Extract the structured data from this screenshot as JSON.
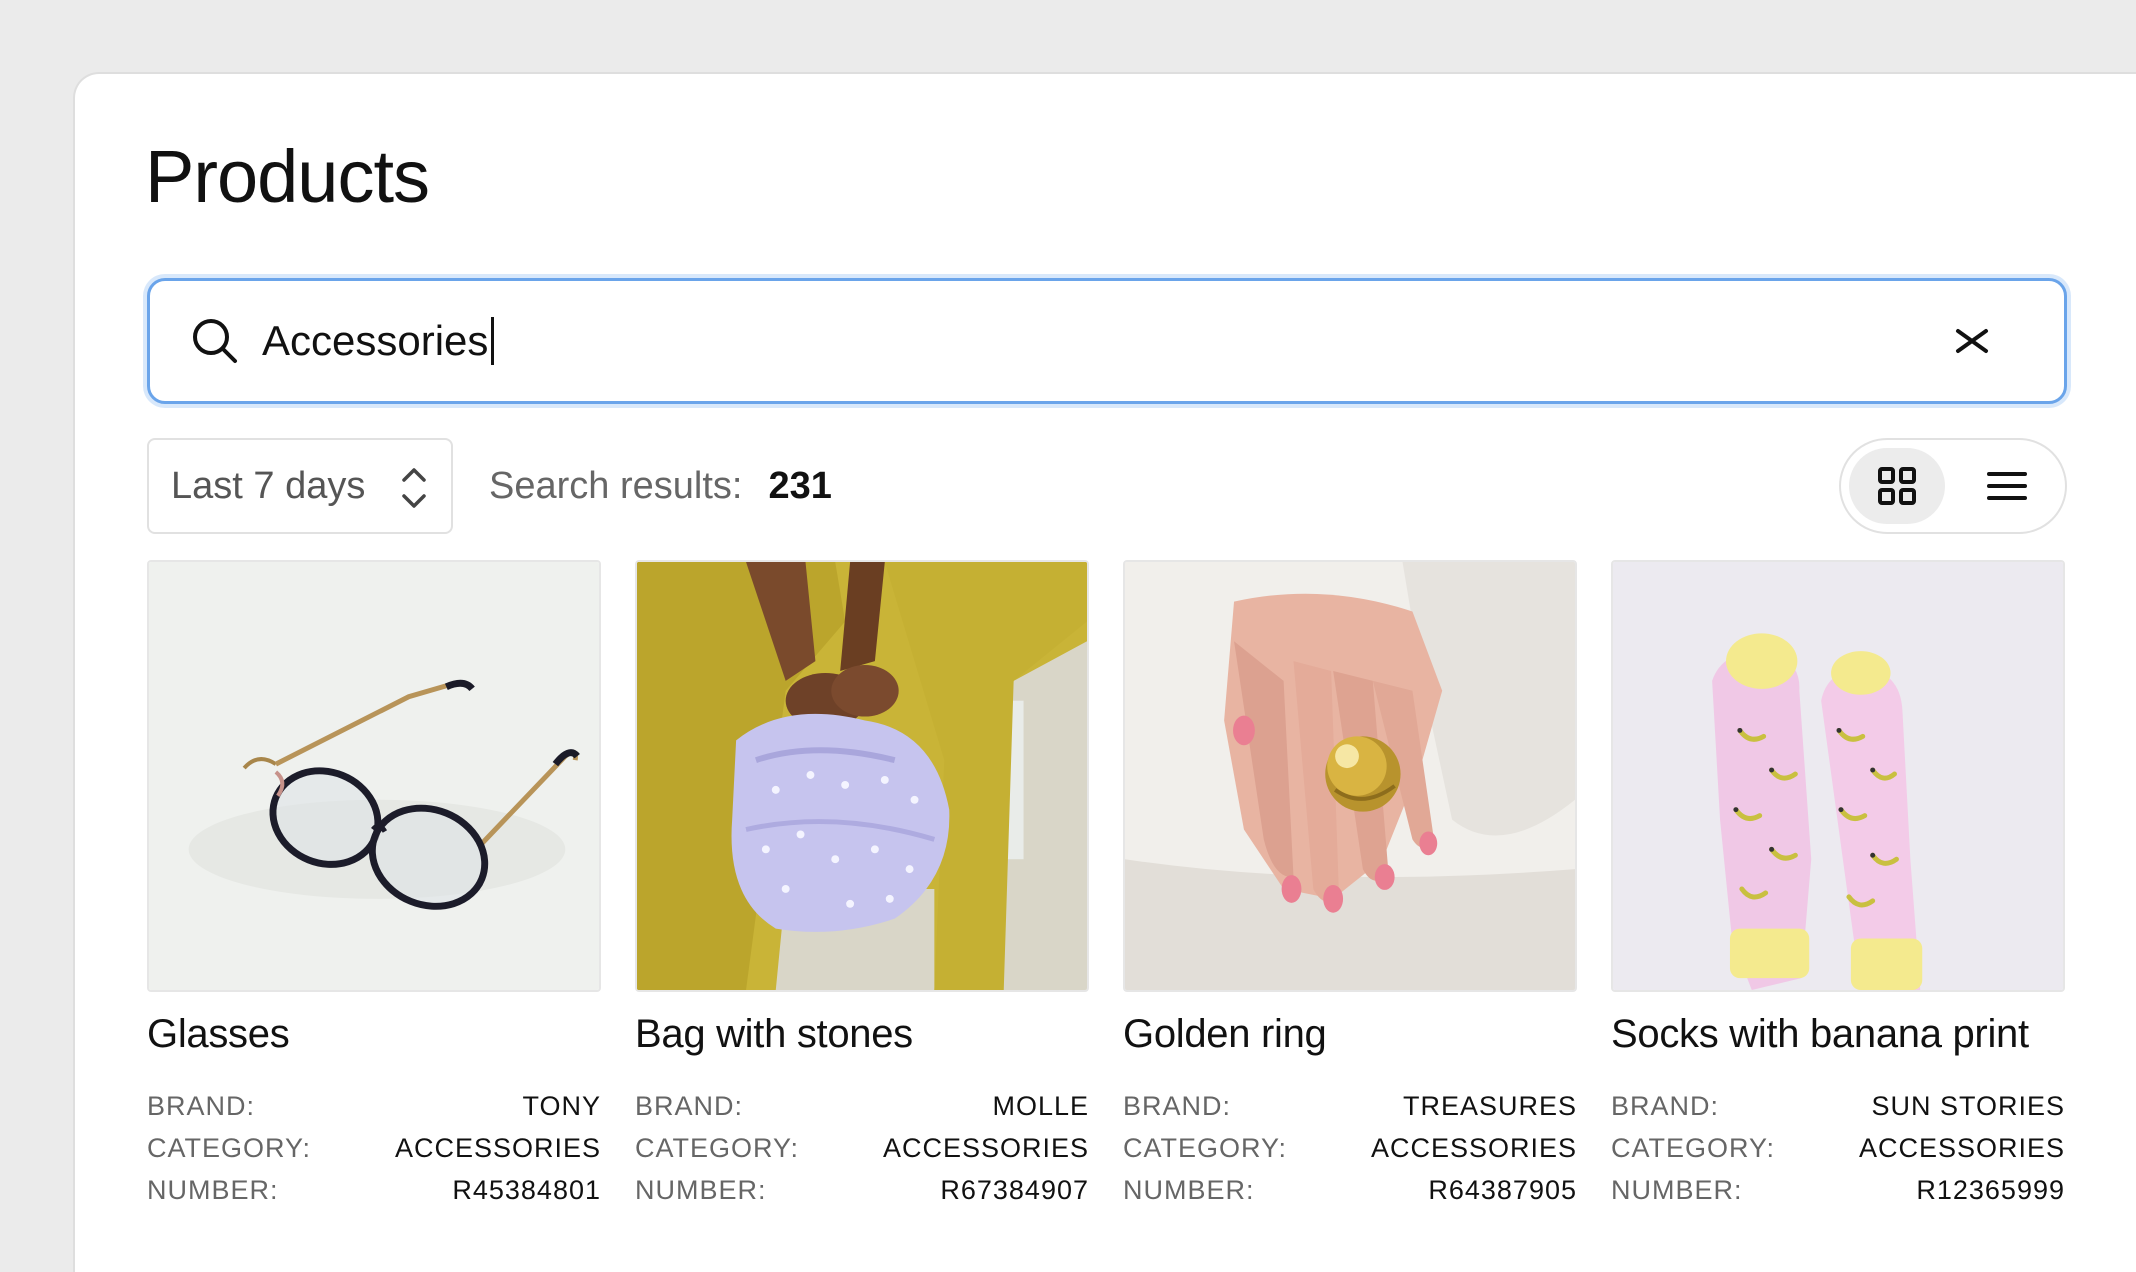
{
  "page": {
    "title": "Products"
  },
  "search": {
    "value": "Accessories",
    "icon": "search-icon",
    "clear_icon": "close-icon",
    "focus_color": "#6aa4ea"
  },
  "toolbar": {
    "date_range": "Last 7 days",
    "results_label": "Search results:",
    "results_count": "231",
    "view_modes": [
      "grid",
      "list"
    ],
    "active_view": "grid"
  },
  "meta_labels": {
    "brand": "BRAND:",
    "category": "CATEGORY:",
    "number": "NUMBER:"
  },
  "products": [
    {
      "name": "Glasses",
      "brand": "TONY",
      "category": "ACCESSORIES",
      "number": "R45384801",
      "image": "glasses"
    },
    {
      "name": "Bag with stones",
      "brand": "MOLLE",
      "category": "ACCESSORIES",
      "number": "R67384907",
      "image": "bag"
    },
    {
      "name": "Golden ring",
      "brand": "TREASURES",
      "category": "ACCESSORIES",
      "number": "R64387905",
      "image": "ring"
    },
    {
      "name": "Socks with banana print",
      "brand": "SUN STORIES",
      "category": "ACCESSORIES",
      "number": "R12365999",
      "image": "socks"
    }
  ]
}
